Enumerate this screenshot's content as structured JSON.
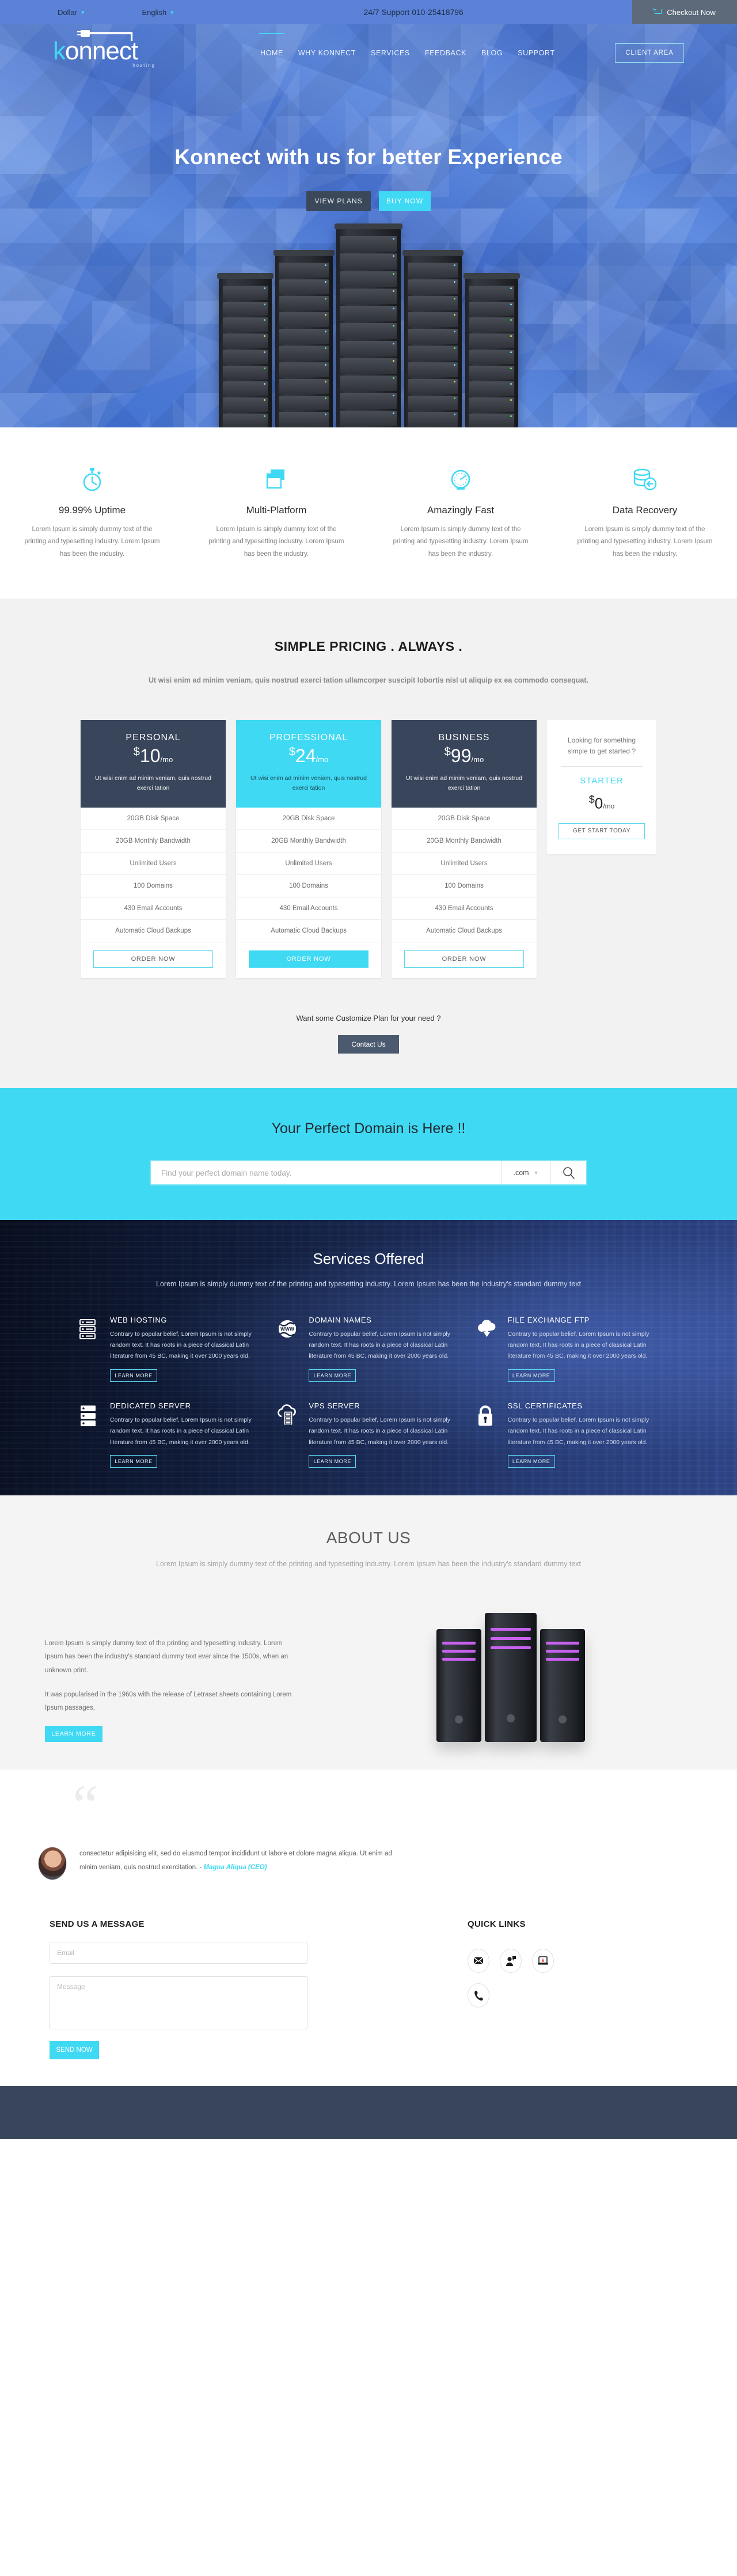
{
  "topbar": {
    "currency": "Dollar",
    "language": "English",
    "support": "24/7 Support 010-25418796",
    "checkout": "Checkout Now",
    "cart_icon": "shopping-cart-icon",
    "caret_icon": "chevron-down-icon"
  },
  "brand": {
    "name_k": "k",
    "name_rest": "onnect",
    "tagline": "hosting"
  },
  "nav": {
    "items": [
      "HOME",
      "WHY KONNECT",
      "SERVICES",
      "FEEDBACK",
      "BLOG",
      "SUPPORT"
    ],
    "client_area": "CLIENT AREA"
  },
  "hero": {
    "title": "Konnect with us for better Experience",
    "btn_plans": "VIEW PLANS",
    "btn_buy": "BUY NOW"
  },
  "features": [
    {
      "icon": "stopwatch-icon",
      "title": "99.99% Uptime",
      "text": "Lorem Ipsum is simply dummy text of the printing and typesetting industry. Lorem Ipsum has been the industry."
    },
    {
      "icon": "windows-stack-icon",
      "title": "Multi-Platform",
      "text": "Lorem Ipsum is simply dummy text of the printing and typesetting industry. Lorem Ipsum has been the industry."
    },
    {
      "icon": "speedometer-icon",
      "title": "Amazingly Fast",
      "text": "Lorem Ipsum is simply dummy text of the printing and typesetting industry. Lorem Ipsum has been the industry."
    },
    {
      "icon": "database-restore-icon",
      "title": "Data Recovery",
      "text": "Lorem Ipsum is simply dummy text of the printing and typesetting industry. Lorem Ipsum has been the industry."
    }
  ],
  "pricing": {
    "title": "SIMPLE PRICING . ALWAYS .",
    "subtitle": "Ut wisi enim ad minim veniam, quis nostrud exerci tation ullamcorper suscipit lobortis nisl ut aliquip ex ea commodo consequat.",
    "plans": [
      {
        "name": "PERSONAL",
        "currency": "$",
        "amount": "10",
        "period": "/mo",
        "desc": "Ut wisi enim ad minim veniam, quis nostrud exerci tation",
        "features": [
          "20GB Disk Space",
          "20GB Monthly Bandwidth",
          "Unlimited Users",
          "100 Domains",
          "430 Email Accounts",
          "Automatic Cloud Backups"
        ],
        "cta": "ORDER NOW",
        "highlight": false
      },
      {
        "name": "PROFESSIONAL",
        "currency": "$",
        "amount": "24",
        "period": "/mo",
        "desc": "Ut wisi enim ad minim veniam, quis nostrud exerci tation",
        "features": [
          "20GB Disk Space",
          "20GB Monthly Bandwidth",
          "Unlimited Users",
          "100 Domains",
          "430 Email Accounts",
          "Automatic Cloud Backups"
        ],
        "cta": "ORDER NOW",
        "highlight": true
      },
      {
        "name": "BUSINESS",
        "currency": "$",
        "amount": "99",
        "period": "/mo",
        "desc": "Ut wisi enim ad minim veniam, quis nostrud exerci tation",
        "features": [
          "20GB Disk Space",
          "20GB Monthly Bandwidth",
          "Unlimited Users",
          "100 Domains",
          "430 Email Accounts",
          "Automatic Cloud Backups"
        ],
        "cta": "ORDER NOW",
        "highlight": false
      }
    ],
    "starter": {
      "question": "Looking for something simple to get started ?",
      "name": "STARTER",
      "currency": "$",
      "amount": "0",
      "period": "/mo",
      "cta": "GET START TODAY"
    },
    "custom_question": "Want some Customize Plan for your need ?",
    "contact_btn": "Contact Us"
  },
  "domain": {
    "title": "Your Perfect Domain is Here !!",
    "placeholder": "Find your perfect domain name today.",
    "tld": ".com",
    "search_icon": "search-icon",
    "caret_icon": "chevron-down-icon"
  },
  "services": {
    "title": "Services Offered",
    "subtitle": "Lorem Ipsum is simply dummy text of the printing and typesetting industry. Lorem Ipsum has been the industry's standard dummy text",
    "body": "Contrary to popular belief, Lorem Ipsum is not simply random text. It has roots in a piece of classical Latin literature from 45 BC, making it over 2000 years old.",
    "learn": "LEARN MORE",
    "items": [
      {
        "icon": "server-rack-icon",
        "name": "WEB HOSTING"
      },
      {
        "icon": "www-globe-icon",
        "name": "DOMAIN NAMES"
      },
      {
        "icon": "cloud-download-icon",
        "name": "FILE EXCHANGE FTP"
      },
      {
        "icon": "dedicated-server-icon",
        "name": "DEDICATED SERVER"
      },
      {
        "icon": "cloud-server-icon",
        "name": "VPS SERVER"
      },
      {
        "icon": "padlock-icon",
        "name": "SSL CERTIFICATES"
      }
    ]
  },
  "about": {
    "title": "ABOUT US",
    "subtitle": "Lorem Ipsum is simply dummy text of the printing and typesetting industry. Lorem Ipsum has been the industry's standard dummy text",
    "p1": "Lorem Ipsum is simply dummy text of the printing and typesetting industry. Lorem Ipsum has been the industry's standard dummy text ever since the 1500s, when an unknown print.",
    "p2": "It was popularised in the 1960s with the release of Letraset sheets containing Lorem Ipsum passages,",
    "learn": "LEARN MORE"
  },
  "testimonial": {
    "quote_mark": "“",
    "text": "consectetur adipisicing elit, sed do eiusmod tempor incididunt ut labore et dolore magna aliqua. Ut enim ad minim veniam, quis nostrud exercitation. - ",
    "author": "Magna Aliqua (CEO)",
    "avatar": "avatar-photo"
  },
  "contact": {
    "title": "SEND US A MESSAGE",
    "email_placeholder": "Email",
    "message_placeholder": "Message",
    "send_btn": "SEND NOW",
    "quick_links_title": "QUICK LINKS",
    "quick_link_icons": [
      "envelope-icon",
      "support-agent-icon",
      "laptop-icon",
      "phone-icon"
    ]
  },
  "colors": {
    "accent_cyan": "#3fd9f4",
    "dark_navy": "#38455a",
    "hero_blue": "#4b78d4"
  }
}
